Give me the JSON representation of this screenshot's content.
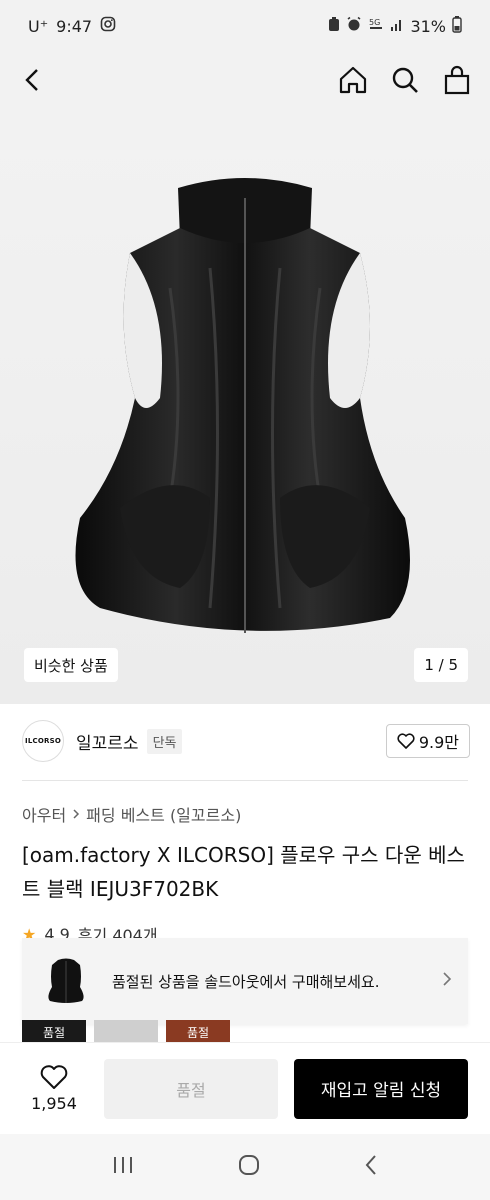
{
  "status_bar": {
    "carrier": "U⁺",
    "time": "9:47",
    "battery": "31%"
  },
  "hero": {
    "similar_label": "비슷한 상품",
    "pager": "1 / 5"
  },
  "brand": {
    "logo_text": "ILCORSO",
    "name": "일꼬르소",
    "badge": "단독",
    "likes": "9.9만"
  },
  "breadcrumb": {
    "category": "아우터",
    "subcategory": "패딩 베스트 (일꼬르소)"
  },
  "product": {
    "title": "[oam.factory X ILCORSO] 플로우 구스 다운 베스트 블랙 IEJU3F702BK",
    "rating": "4.9",
    "reviews": "후기 404개"
  },
  "soldout_banner": {
    "text": "품절된 상품을 솔드아웃에서 구매해보세요."
  },
  "thumbs": [
    {
      "label": "품절",
      "color": "#1a1a1a"
    },
    {
      "label": "",
      "color": "#cfcfcf"
    },
    {
      "label": "품절",
      "color": "#8a3a22"
    }
  ],
  "action_bar": {
    "wish_count": "1,954",
    "soldout_label": "품절",
    "restock_label": "재입고 알림 신청"
  },
  "colors": {
    "accent": "#000000",
    "star": "#f5a623"
  }
}
